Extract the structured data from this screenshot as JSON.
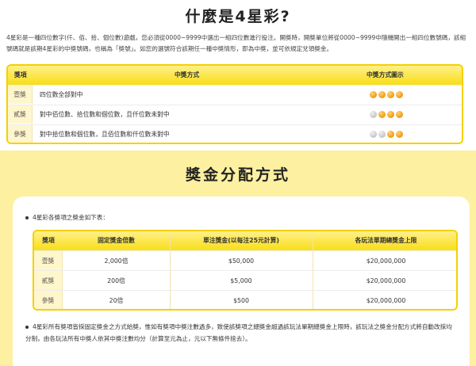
{
  "section1": {
    "title": "什麼是4星彩?",
    "intro": "4星彩是一種四位數字(仟、佰、拾、個位數)遊戲，您必須從0000~9999中選出一組四位數進行投注。開獎時，開獎單位將從0000~9999中隨機開出一組四位數號碼，該組號碼就是該期4星彩的中獎號碼，也稱為「獎號」。如您的選號符合該期任一種中獎情形，即為中獎，並可依規定兌領獎金。",
    "table": {
      "headers": [
        "獎項",
        "中獎方式",
        "中獎方式圖示"
      ],
      "rows": [
        {
          "label": "壹獎",
          "desc": "四位數全部對中",
          "balls": [
            "on",
            "on",
            "on",
            "on"
          ]
        },
        {
          "label": "貳獎",
          "desc": "對中佰位數、拾位數和個位數，且仟位數未對中",
          "balls": [
            "off",
            "on",
            "on",
            "on"
          ]
        },
        {
          "label": "參獎",
          "desc": "對中拾位數和個位數，且佰位數和仟位數未對中",
          "balls": [
            "off",
            "off",
            "on",
            "on"
          ]
        }
      ]
    }
  },
  "section2": {
    "title": "獎金分配方式",
    "bullet": "4星彩各獎項之獎金如下表：",
    "table": {
      "headers": [
        "獎項",
        "固定獎金倍數",
        "單注獎金(以每注25元計算)",
        "各玩法單期總獎金上限"
      ],
      "rows": [
        {
          "label": "壹獎",
          "mult": "2,000倍",
          "prize": "$50,000",
          "cap": "$20,000,000"
        },
        {
          "label": "貳獎",
          "mult": "200倍",
          "prize": "$5,000",
          "cap": "$20,000,000"
        },
        {
          "label": "參獎",
          "mult": "20倍",
          "prize": "$500",
          "cap": "$20,000,000"
        }
      ]
    },
    "note": "4星彩所有獎項皆採固定獎金之方式給獎，惟如有獎項中獎注數過多，致使該獎項之總獎金超過該玩法單期總獎金上限時，該玩法之獎金分配方式將自動改採均分制，由各玩法所有中獎人依其中獎注數均分（計算至元為止，元以下無條件捨去）。"
  },
  "colors": {
    "accent": "#f5d000",
    "ball_on": "#f09a10",
    "ball_off": "#c5c5c5",
    "bg_yellow": "#fdf0a0"
  }
}
